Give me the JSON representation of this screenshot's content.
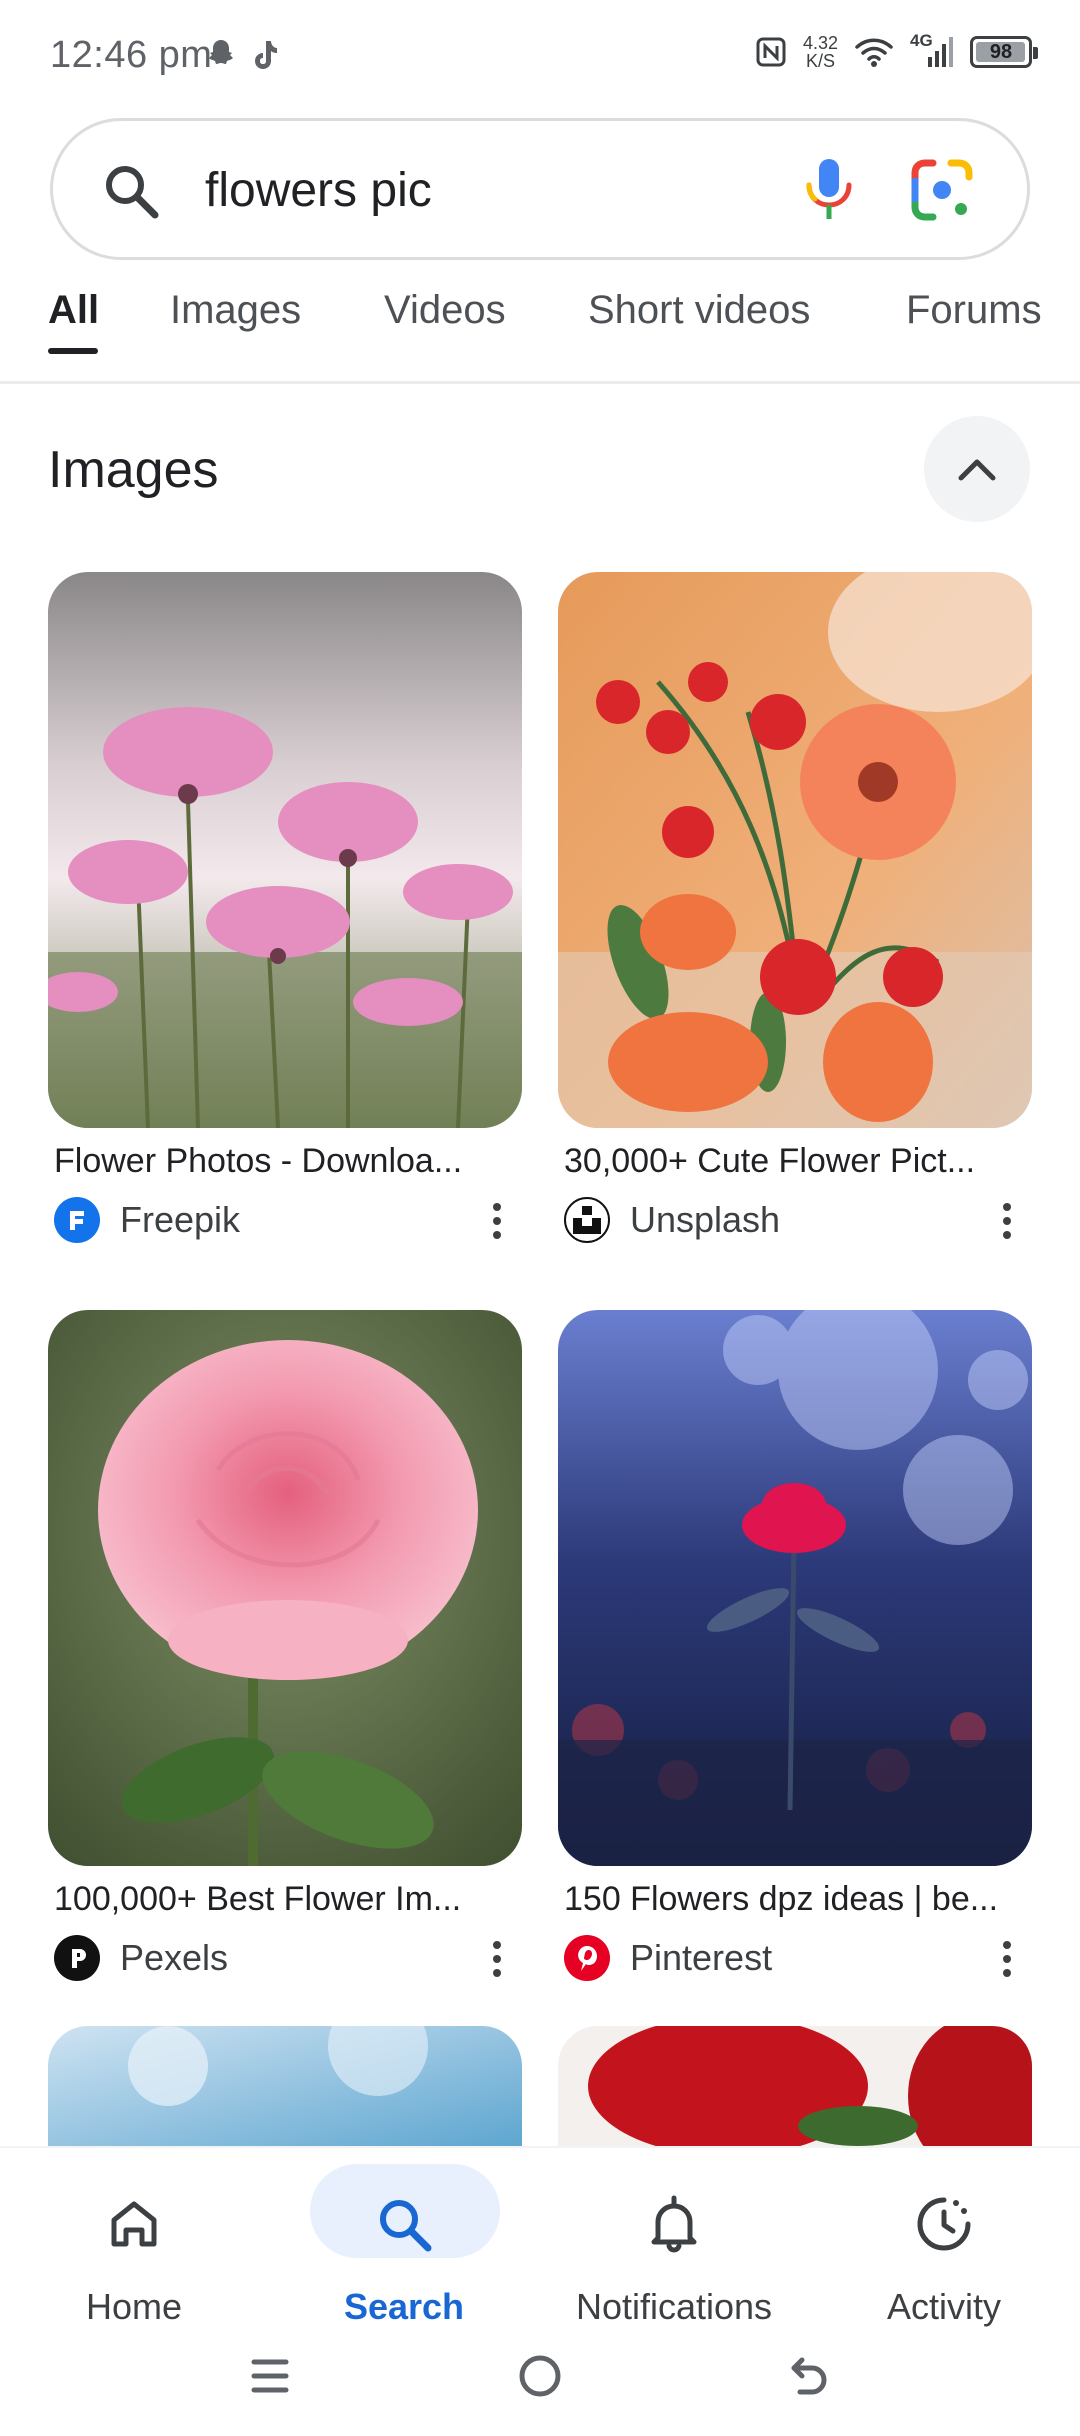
{
  "status_bar": {
    "time": "12:46 pm",
    "left_icons": [
      "snapchat-icon",
      "tiktok-icon"
    ],
    "speed_value": "4.32",
    "speed_unit": "K/S",
    "network": "4G",
    "battery": "98",
    "battery_level": 0.98
  },
  "search": {
    "query": "flowers pic"
  },
  "tabs": [
    {
      "label": "All",
      "active": true
    },
    {
      "label": "Images"
    },
    {
      "label": "Videos"
    },
    {
      "label": "Short videos"
    },
    {
      "label": "Forums"
    }
  ],
  "section": {
    "title": "Images"
  },
  "results": [
    {
      "title": "Flower Photos - Downloa...",
      "source": "Freepik",
      "source_color": "#1273eb"
    },
    {
      "title": "30,000+ Cute Flower Pict...",
      "source": "Unsplash",
      "source_color": "#111111"
    },
    {
      "title": "100,000+ Best Flower Im...",
      "source": "Pexels",
      "source_color": "#111111"
    },
    {
      "title": "150 Flowers dpz ideas | be...",
      "source": "Pinterest",
      "source_color": "#e60023"
    }
  ],
  "bottom_nav": [
    {
      "label": "Home",
      "icon": "home-icon"
    },
    {
      "label": "Search",
      "icon": "search-icon",
      "active": true
    },
    {
      "label": "Notifications",
      "icon": "bell-icon"
    },
    {
      "label": "Activity",
      "icon": "activity-icon"
    }
  ],
  "colors": {
    "accent": "#1967d2",
    "active_pill": "#e8f0fe"
  }
}
